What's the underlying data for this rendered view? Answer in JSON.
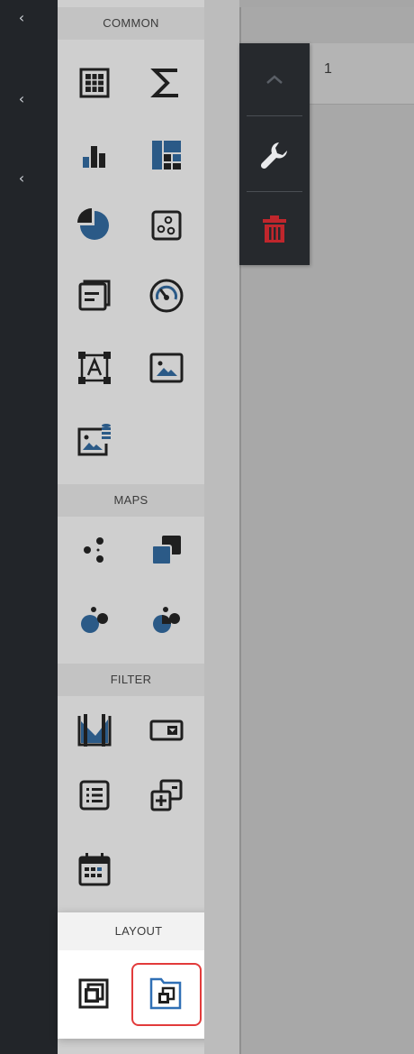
{
  "rail": {
    "chevrons": [
      "‹",
      "‹",
      "‹"
    ]
  },
  "sections": {
    "common": "COMMON",
    "maps": "MAPS",
    "filter": "FILTER",
    "layout": "LAYOUT"
  },
  "item": {
    "title": "1"
  },
  "colors": {
    "accent_blue": "#2b5a87",
    "danger_red": "#c0262c",
    "icon_dark": "#1f1f1f",
    "selection_border": "#e23b3b"
  },
  "icons": {
    "common": [
      "grid-icon",
      "sum-icon",
      "bar-chart-icon",
      "treemap-icon",
      "pie-chart-icon",
      "scatter-chart-icon",
      "card-icon",
      "gauge-icon",
      "text-box-icon",
      "image-icon",
      "bound-image-icon"
    ],
    "maps": [
      "geo-point-map-icon",
      "choropleth-map-icon",
      "bubble-map-icon",
      "pie-map-icon"
    ],
    "filter": [
      "range-filter-icon",
      "combo-box-icon",
      "list-box-icon",
      "tree-view-icon",
      "date-filter-icon"
    ],
    "layout": [
      "group-icon",
      "tab-container-icon"
    ],
    "item_toolbar": [
      "chevron-up-icon",
      "wrench-icon",
      "trash-icon"
    ]
  }
}
